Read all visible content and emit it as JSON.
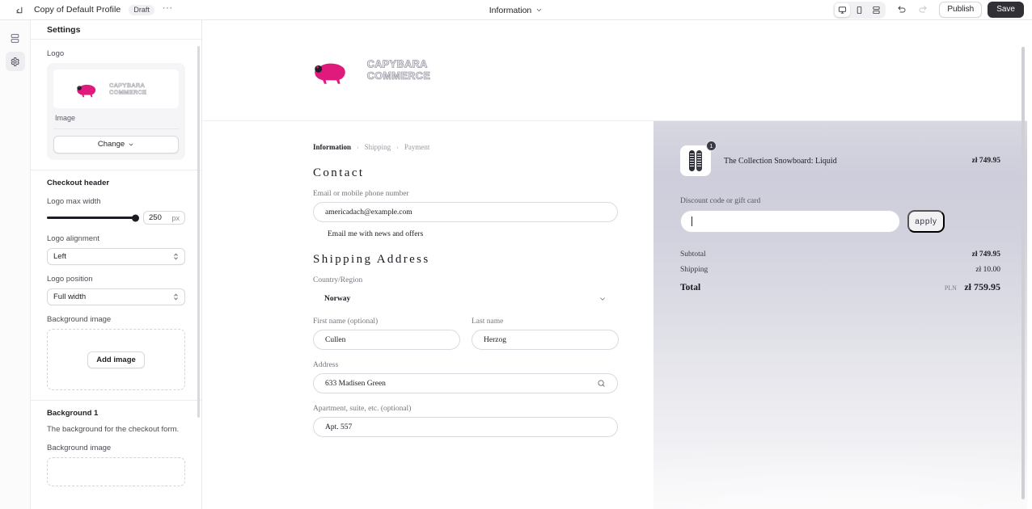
{
  "topbar": {
    "back_icon": "back-arrow-icon",
    "profile_name": "Copy of Default Profile",
    "status_badge": "Draft",
    "more_label": "···",
    "page_selector": "Information",
    "devices": [
      {
        "name": "desktop-view",
        "label": "desktop",
        "active": true
      },
      {
        "name": "mobile-view",
        "label": "mobile",
        "active": false
      },
      {
        "name": "split-view",
        "label": "split",
        "active": false
      }
    ],
    "undo_label": "undo",
    "redo_label": "redo",
    "publish_label": "Publish",
    "save_label": "Save"
  },
  "rail": {
    "items": [
      {
        "name": "sections-icon",
        "label": "Sections",
        "active": false
      },
      {
        "name": "settings-gear-icon",
        "label": "Settings",
        "active": true
      }
    ]
  },
  "settings": {
    "title": "Settings",
    "logo": {
      "label": "Logo",
      "alt_text": "CAPYBARA COMMERCE",
      "meta": "Image",
      "change_label": "Change"
    },
    "checkout_header": {
      "title": "Checkout header",
      "logo_max_width_label": "Logo max width",
      "logo_max_width_value": "250",
      "logo_max_width_unit": "px",
      "logo_alignment_label": "Logo alignment",
      "logo_alignment_value": "Left",
      "logo_position_label": "Logo position",
      "logo_position_value": "Full width",
      "background_image_label": "Background image",
      "add_image_label": "Add image"
    },
    "background_1": {
      "title": "Background 1",
      "description": "The background for the checkout form.",
      "background_image_label": "Background image"
    }
  },
  "checkout": {
    "logo_alt": "CAPYBARA COMMERCE",
    "breadcrumb": [
      {
        "label": "Information",
        "current": true
      },
      {
        "label": "Shipping",
        "current": false
      },
      {
        "label": "Payment",
        "current": false
      }
    ],
    "breadcrumb_sep": "›",
    "contact": {
      "heading": "Contact",
      "email_label": "Email or mobile phone number",
      "email_value": "americadach@example.com",
      "newsletter_label": "Email me with news and offers"
    },
    "shipping": {
      "heading": "Shipping Address",
      "country_label": "Country/Region",
      "country_value": "Norway",
      "first_name_label": "First name (optional)",
      "first_name_value": "Cullen",
      "last_name_label": "Last name",
      "last_name_value": "Herzog",
      "address_label": "Address",
      "address_value": "633 Madisen Green",
      "apartment_label": "Apartment, suite, etc. (optional)",
      "apartment_value": "Apt. 557"
    },
    "summary": {
      "product_name": "The Collection Snowboard: Liquid",
      "product_price": "zł 749.95",
      "product_quantity": "1",
      "discount_label": "Discount code or gift card",
      "discount_value": "",
      "apply_label": "apply",
      "subtotal_label": "Subtotal",
      "subtotal_value": "zł 749.95",
      "shipping_label": "Shipping",
      "shipping_value": "zł 10.00",
      "total_label": "Total",
      "total_currency": "PLN",
      "total_value": "zł 759.95"
    }
  },
  "colors": {
    "brand_pink": "#e0197d",
    "dark_button": "#303036",
    "panel_bg": "#ffffff",
    "summary_bg": "#d8d8e2"
  }
}
